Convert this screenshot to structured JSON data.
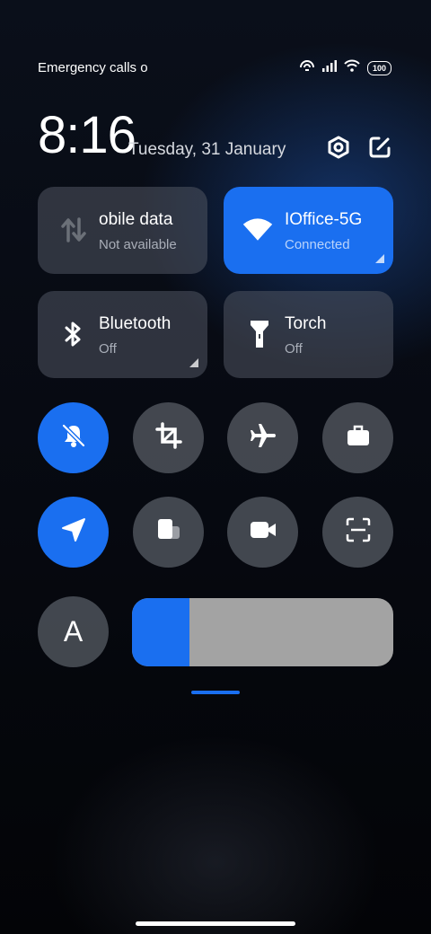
{
  "status_bar": {
    "text": "Emergency calls o",
    "battery": "100",
    "icons": [
      "hotspot-icon",
      "signal-icon",
      "wifi-icon",
      "battery-icon"
    ]
  },
  "header": {
    "time": "8:16",
    "date": "Tuesday, 31 January",
    "icons": [
      "settings-icon",
      "edit-icon"
    ]
  },
  "tiles": [
    {
      "name": "mobile-data",
      "title": "obile data",
      "subtitle": "Not available",
      "icon": "data-arrows-icon"
    },
    {
      "name": "wifi",
      "title": "IOffice-5G",
      "subtitle": "Connected",
      "icon": "wifi-icon",
      "active_color": "#1a6ff0"
    },
    {
      "name": "bluetooth",
      "title": "Bluetooth",
      "subtitle": "Off",
      "icon": "bluetooth-icon"
    },
    {
      "name": "torch",
      "title": "Torch",
      "subtitle": "Off",
      "icon": "torch-icon"
    }
  ],
  "toggles": [
    {
      "name": "silent",
      "icon": "bell-off-icon",
      "active": true
    },
    {
      "name": "screenshot",
      "icon": "crop-icon",
      "active": false
    },
    {
      "name": "airplane-mode",
      "icon": "airplane-icon",
      "active": false
    },
    {
      "name": "work-mode",
      "icon": "briefcase-icon",
      "active": false
    },
    {
      "name": "location",
      "icon": "location-arrow-icon",
      "active": true
    },
    {
      "name": "floating-window",
      "icon": "floating-window-icon",
      "active": false
    },
    {
      "name": "screen-recorder",
      "icon": "video-camera-icon",
      "active": false
    },
    {
      "name": "scanner",
      "icon": "scan-icon",
      "active": false
    }
  ],
  "auto_brightness": {
    "label": "A"
  },
  "brightness": {
    "level": 0.22
  },
  "colors": {
    "accent": "#1a6ff0",
    "tile_bg": "#50566280",
    "slider_track": "#a3a3a3"
  }
}
